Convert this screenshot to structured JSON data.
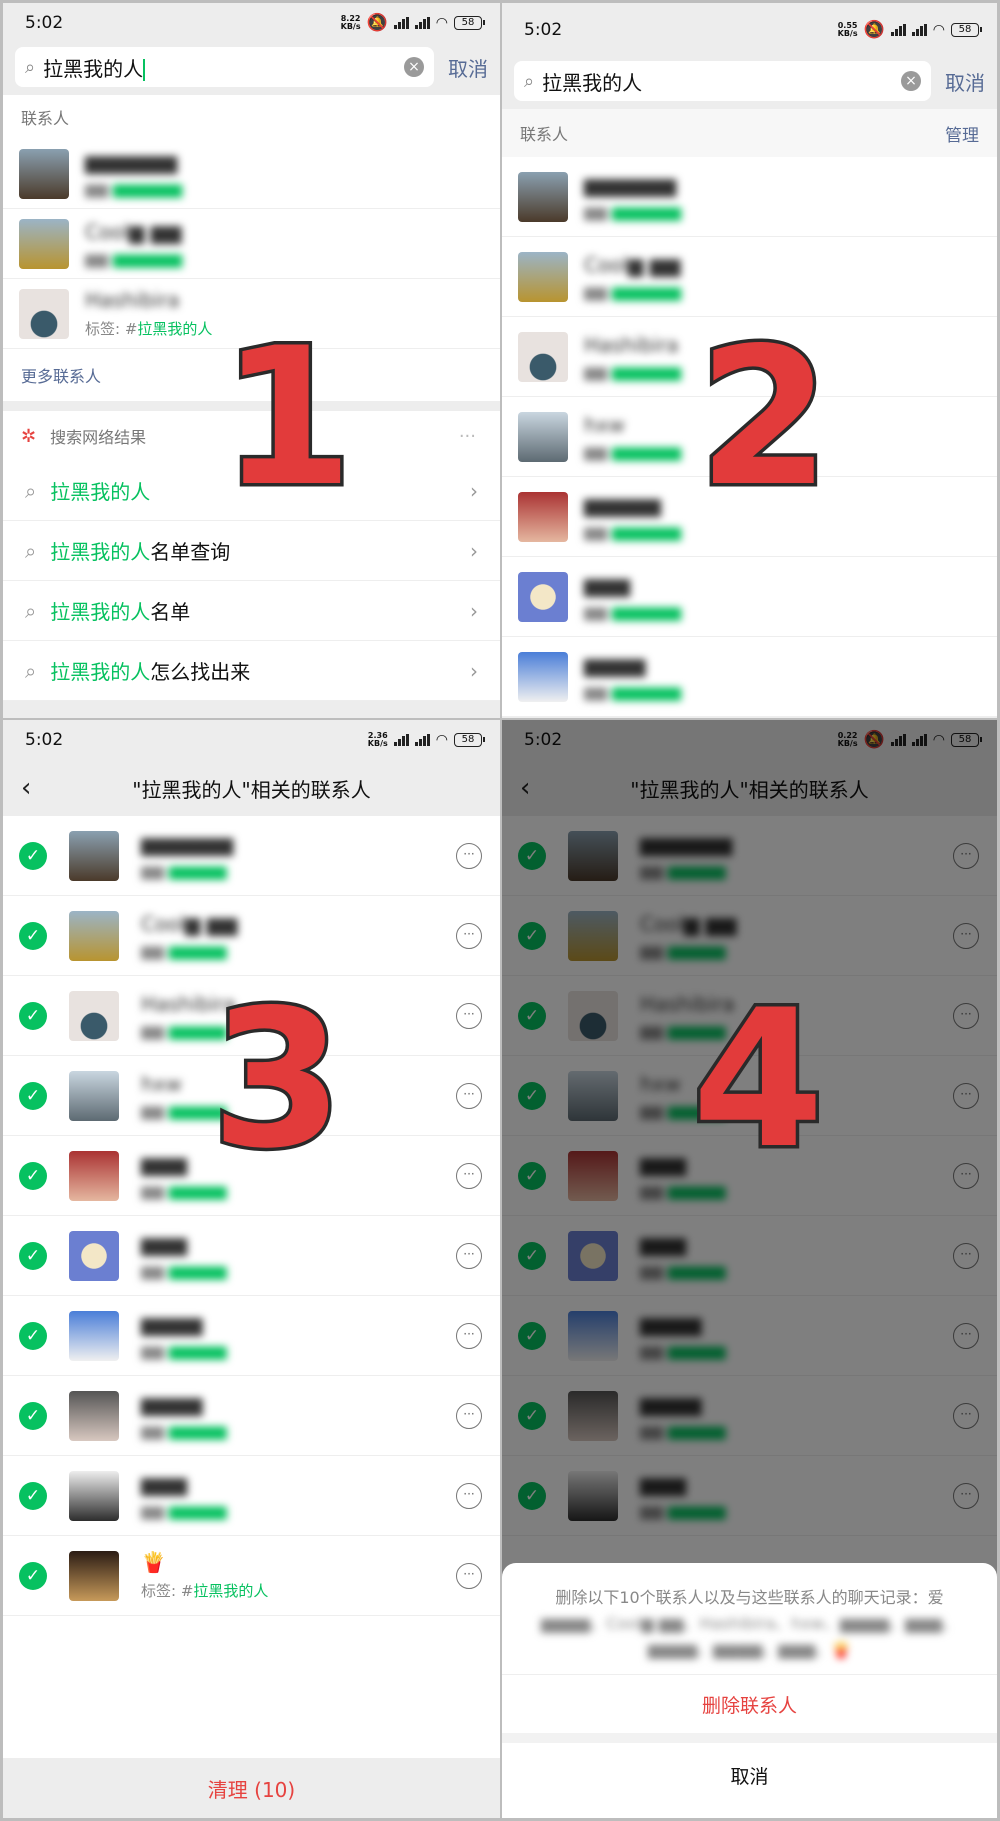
{
  "time": "5:02",
  "p1": {
    "speed": "8.22\nKB/s",
    "battery": "58",
    "search_text": "拉黑我的人",
    "cancel": "取消",
    "section": "联系人",
    "tag_label": "标签: #",
    "tag_value": "拉黑我的人",
    "more": "更多联系人",
    "web_head": "搜索网络结果",
    "suggestions": [
      {
        "hl": "拉黑我的人",
        "rest": ""
      },
      {
        "hl": "拉黑我的人",
        "rest": "名单查询"
      },
      {
        "hl": "拉黑我的人",
        "rest": "名单"
      },
      {
        "hl": "拉黑我的人",
        "rest": "怎么找出来"
      }
    ],
    "label": "1"
  },
  "p2": {
    "speed": "0.55\nKB/s",
    "battery": "58",
    "search_text": "拉黑我的人",
    "cancel": "取消",
    "section": "联系人",
    "manage": "管理",
    "label": "2"
  },
  "p3": {
    "speed": "2.36\nKB/s",
    "battery": "58",
    "title": "\"拉黑我的人\"相关的联系人",
    "tag_label": "标签: #",
    "tag_value": "拉黑我的人",
    "clean": "清理 (10)",
    "label": "3"
  },
  "p4": {
    "speed": "0.22\nKB/s",
    "battery": "58",
    "title": "\"拉黑我的人\"相关的联系人",
    "sheet_msg": "删除以下10个联系人以及与这些联系人的聊天记录：爱",
    "delete": "删除联系人",
    "cancel": "取消",
    "label": "4"
  },
  "colors": {
    "green": "#07c160",
    "link": "#576b95",
    "red": "#e64340",
    "label_red": "#e23b3b"
  }
}
